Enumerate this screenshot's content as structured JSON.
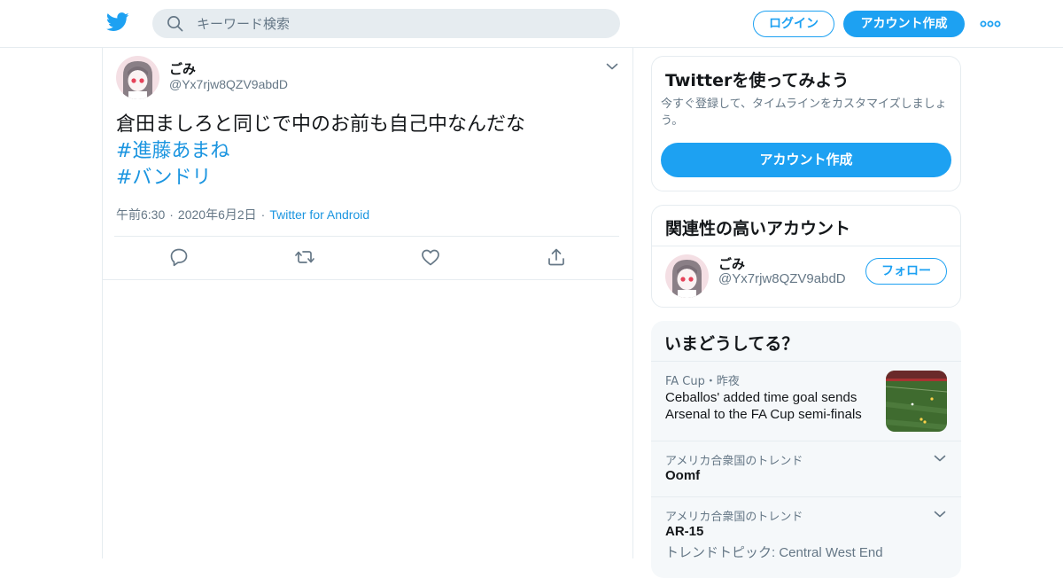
{
  "header": {
    "search_placeholder": "キーワード検索",
    "login_label": "ログイン",
    "signup_label": "アカウント作成",
    "brand_color": "#1da1f2"
  },
  "tweet": {
    "display_name": "ごみ",
    "handle": "@Yx7rjw8QZV9abdD",
    "text": "倉田ましろと同じで中のお前も自己中なんだな",
    "hashtags": [
      "#進藤あまね",
      "#バンドリ"
    ],
    "time": "午前6:30",
    "date": "2020年6月2日",
    "source": "Twitter for Android",
    "actions": [
      "reply-icon",
      "retweet-icon",
      "like-icon",
      "share-icon"
    ]
  },
  "signup_card": {
    "title": "Twitterを使ってみよう",
    "description": "今すぐ登録して、タイムラインをカスタマイズしましょう。",
    "button_label": "アカウント作成"
  },
  "related": {
    "title": "関連性の高いアカウント",
    "name": "ごみ",
    "handle": "@Yx7rjw8QZV9abdD",
    "follow_label": "フォロー"
  },
  "trends": {
    "title": "いまどうしてる？",
    "items": [
      {
        "meta": "FA Cup・昨夜",
        "headline": "Ceballos' added time goal sends Arsenal to the FA Cup semi-finals"
      },
      {
        "meta": "アメリカ合衆国のトレンド",
        "name": "Oomf"
      },
      {
        "meta": "アメリカ合衆国のトレンド",
        "name": "AR-15",
        "sub": "トレンドトピック: Central West End"
      }
    ]
  }
}
